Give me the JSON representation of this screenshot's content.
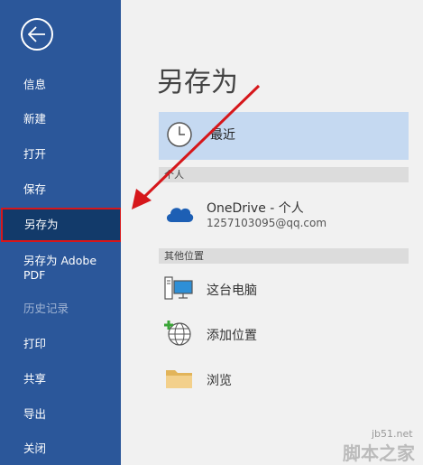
{
  "nav": {
    "items": [
      {
        "label": "信息"
      },
      {
        "label": "新建"
      },
      {
        "label": "打开"
      },
      {
        "label": "保存"
      },
      {
        "label": "另存为"
      },
      {
        "label": "另存为 Adobe PDF"
      },
      {
        "label": "历史记录"
      },
      {
        "label": "打印"
      },
      {
        "label": "共享"
      },
      {
        "label": "导出"
      },
      {
        "label": "关闭"
      }
    ]
  },
  "main": {
    "title": "另存为",
    "recent_label": "最近",
    "personal_section": "个人",
    "onedrive_name": "OneDrive - 个人",
    "onedrive_email": "1257103095@qq.com",
    "other_section": "其他位置",
    "this_pc": "这台电脑",
    "add_place": "添加位置",
    "browse": "浏览"
  },
  "watermark": {
    "line1": "jb51.net",
    "line2": "脚本之家"
  },
  "colors": {
    "nav_bg": "#2b579a",
    "selected_bg": "#123a6a",
    "highlight_red": "#d6171b",
    "recent_bg": "#c5d9f1"
  }
}
